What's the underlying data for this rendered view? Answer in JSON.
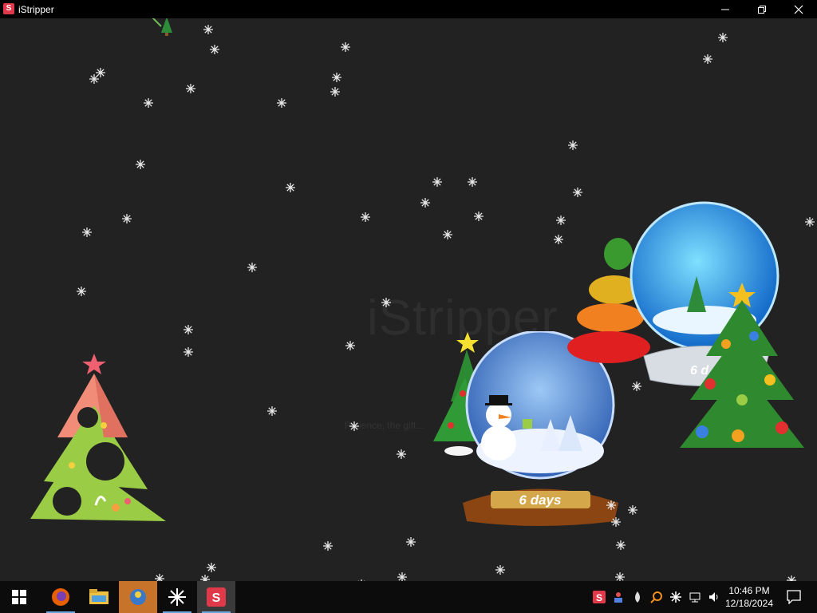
{
  "window": {
    "title": "iStripper",
    "app_icon_glyph": "S",
    "controls": {
      "minimize": "minimize-icon",
      "maximize": "restore-icon",
      "close": "close-icon"
    }
  },
  "desktop": {
    "watermark": "iStripper",
    "subtext": "Patience, the gift...",
    "countdown_label": "6 days",
    "countdown_label_partial": "6 d"
  },
  "taskbar": {
    "start_icon": "windows-logo-icon",
    "apps": [
      {
        "name": "firefox",
        "icon": "firefox-icon"
      },
      {
        "name": "file-explorer",
        "icon": "folder-icon"
      },
      {
        "name": "app",
        "icon": "app-icon"
      },
      {
        "name": "snowflake-app",
        "icon": "snowflake-icon"
      },
      {
        "name": "istripper",
        "icon": "istripper-icon"
      }
    ],
    "tray_icons": [
      "istripper-tray-icon",
      "people-icon",
      "drop-icon",
      "search-tray-icon",
      "snowflake-tray-icon",
      "network-icon",
      "volume-icon"
    ],
    "clock": {
      "time": "10:46 PM",
      "date": "12/18/2024"
    },
    "notification_icon": "action-center-icon"
  },
  "colors": {
    "titlebar": "#000000",
    "desktop": "#222222",
    "taskbar": "#0c0c0c",
    "accent": "#e03a4a"
  }
}
